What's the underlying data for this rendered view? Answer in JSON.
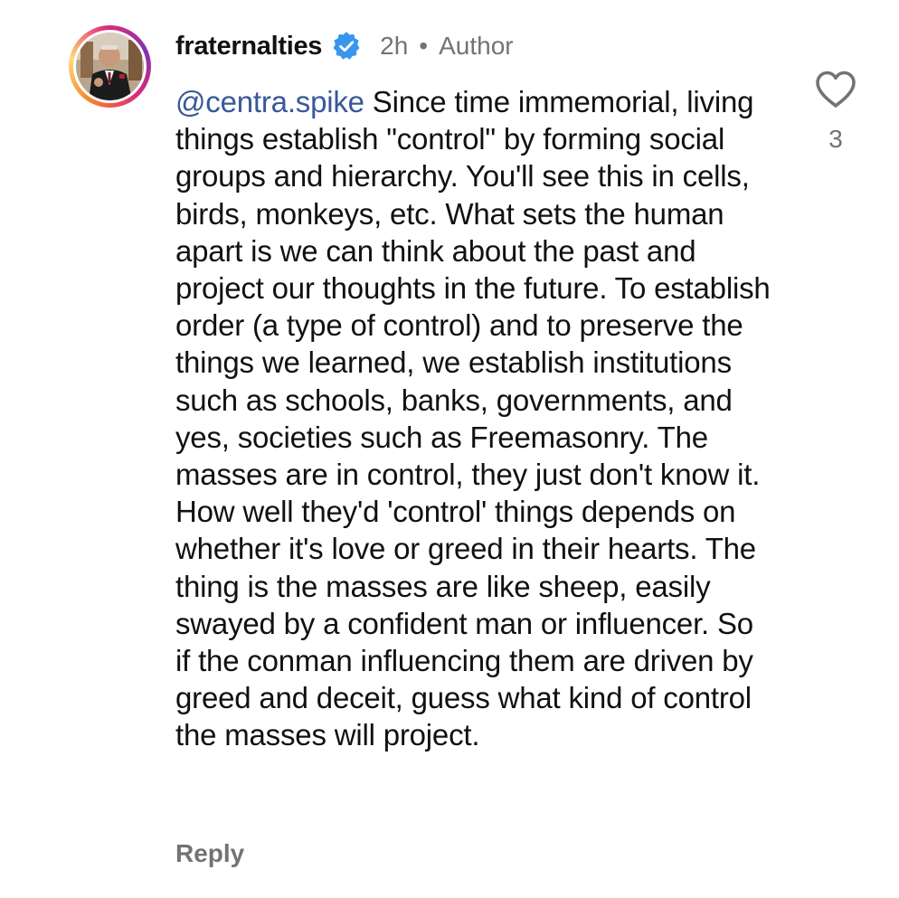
{
  "comment": {
    "username": "fraternalties",
    "verified_icon": "verified-badge-icon",
    "time": "2h",
    "separator": "•",
    "role": "Author",
    "mention": "@centra.spike",
    "text": " Since time immemorial, living things establish \"control\" by forming social groups and hierarchy. You'll see this in cells, birds, monkeys, etc. What sets the human apart is we can think about the past and project our thoughts in the future. To establish order (a type of control) and to preserve the things we learned, we establish institutions such as schools, banks, governments, and yes, societies such as Freemasonry. The masses are in control, they just don't know it. How well they'd 'control' things depends on whether it's love or greed in their hearts. The thing is the masses are like sheep, easily swayed by a confident man or influencer. So if the conman influencing them are driven by greed and deceit, guess what kind of control the masses will project.",
    "reply_label": "Reply",
    "like_icon": "heart-icon",
    "like_count": "3"
  },
  "colors": {
    "mention": "#385898",
    "secondary_text": "#737373",
    "verified": "#3797f0"
  }
}
